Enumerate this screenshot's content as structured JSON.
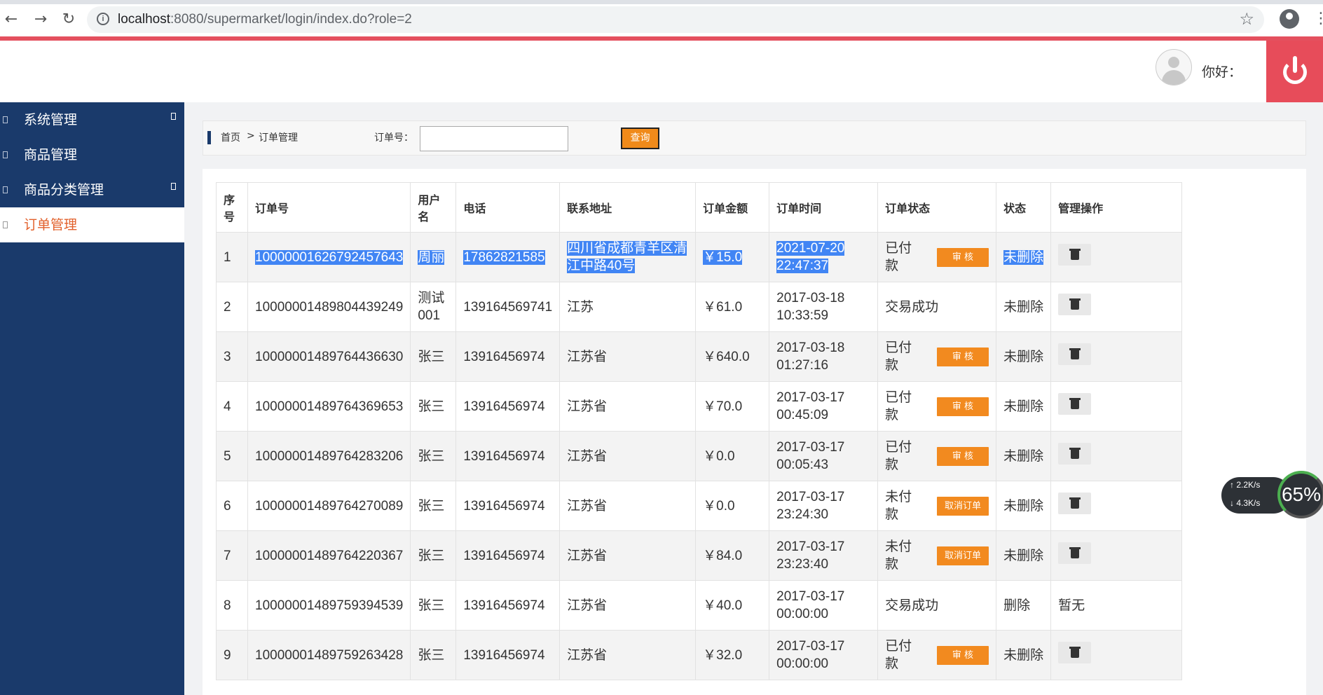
{
  "browser": {
    "url_host": "localhost",
    "url_rest": ":8080/supermarket/login/index.do?role=2"
  },
  "header": {
    "greeting": "你好："
  },
  "sidebar": {
    "items": [
      {
        "label": "系统管理"
      },
      {
        "label": "商品管理"
      },
      {
        "label": "商品分类管理"
      },
      {
        "label": "订单管理"
      }
    ]
  },
  "toolbar": {
    "home": "首页",
    "separator": ">",
    "current": "订单管理",
    "order_label": "订单号：",
    "order_value": "",
    "search_label": "查询"
  },
  "table": {
    "columns": [
      "序号",
      "订单号",
      "用户名",
      "电话",
      "联系地址",
      "订单金额",
      "订单时间",
      "订单状态",
      "状态",
      "管理操作"
    ],
    "rows": [
      {
        "idx": "1",
        "order_no": "10000001626792457643",
        "user": "周丽",
        "phone": "17862821585",
        "address": "四川省成都青羊区清江中路40号",
        "amount": "￥15.0",
        "time": "2021-07-20 22:47:37",
        "order_status": "已付款",
        "action": "审 核",
        "state": "未删除",
        "op": "delete"
      },
      {
        "idx": "2",
        "order_no": "10000001489804439249",
        "user": "测试001",
        "phone": "139164569741",
        "address": "江苏",
        "amount": "￥61.0",
        "time": "2017-03-18 10:33:59",
        "order_status": "交易成功",
        "action": "",
        "state": "未删除",
        "op": "delete"
      },
      {
        "idx": "3",
        "order_no": "10000001489764436630",
        "user": "张三",
        "phone": "13916456974",
        "address": "江苏省",
        "amount": "￥640.0",
        "time": "2017-03-18 01:27:16",
        "order_status": "已付款",
        "action": "审 核",
        "state": "未删除",
        "op": "delete"
      },
      {
        "idx": "4",
        "order_no": "10000001489764369653",
        "user": "张三",
        "phone": "13916456974",
        "address": "江苏省",
        "amount": "￥70.0",
        "time": "2017-03-17 00:45:09",
        "order_status": "已付款",
        "action": "审 核",
        "state": "未删除",
        "op": "delete"
      },
      {
        "idx": "5",
        "order_no": "10000001489764283206",
        "user": "张三",
        "phone": "13916456974",
        "address": "江苏省",
        "amount": "￥0.0",
        "time": "2017-03-17 00:05:43",
        "order_status": "已付款",
        "action": "审 核",
        "state": "未删除",
        "op": "delete"
      },
      {
        "idx": "6",
        "order_no": "10000001489764270089",
        "user": "张三",
        "phone": "13916456974",
        "address": "江苏省",
        "amount": "￥0.0",
        "time": "2017-03-17 23:24:30",
        "order_status": "未付款",
        "action": "取消订单",
        "state": "未删除",
        "op": "delete"
      },
      {
        "idx": "7",
        "order_no": "10000001489764220367",
        "user": "张三",
        "phone": "13916456974",
        "address": "江苏省",
        "amount": "￥84.0",
        "time": "2017-03-17 23:23:40",
        "order_status": "未付款",
        "action": "取消订单",
        "state": "未删除",
        "op": "delete"
      },
      {
        "idx": "8",
        "order_no": "10000001489759394539",
        "user": "张三",
        "phone": "13916456974",
        "address": "江苏省",
        "amount": "￥40.0",
        "time": "2017-03-17 00:00:00",
        "order_status": "交易成功",
        "action": "",
        "state": "删除",
        "op_text": "暂无",
        "op": "none"
      },
      {
        "idx": "9",
        "order_no": "10000001489759263428",
        "user": "张三",
        "phone": "13916456974",
        "address": "江苏省",
        "amount": "￥32.0",
        "time": "2017-03-17 00:00:00",
        "order_status": "已付款",
        "action": "审 核",
        "state": "未删除",
        "op": "delete"
      }
    ]
  },
  "speed_widget": {
    "up": "↑ 2.2K/s",
    "down": "↓ 4.3K/s",
    "percent": "65%"
  },
  "colors": {
    "sidebar": "#1a3a6b",
    "accent": "#f28a1f",
    "power": "#e74c5a",
    "selection": "#4185f4"
  }
}
